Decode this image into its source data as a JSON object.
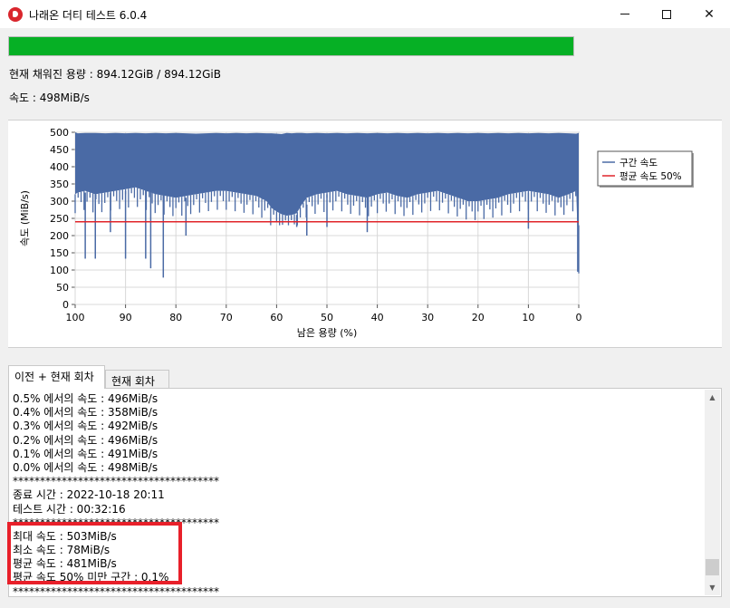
{
  "window": {
    "title": "나래온 더티 테스트 6.0.4"
  },
  "progress": {
    "fraction": 1.0,
    "color": "#06b025"
  },
  "status": {
    "capacity": "현재 채워진 용량 : 894.12GiB / 894.12GiB",
    "speed": "속도 : 498MiB/s"
  },
  "chart_data": {
    "type": "area",
    "xlabel": "남은 용량 (%)",
    "ylabel": "속도 (MiB/s)",
    "xlim": [
      100,
      0
    ],
    "ylim": [
      0,
      500
    ],
    "x_ticks": [
      "100",
      "90",
      "80",
      "70",
      "60",
      "50",
      "40",
      "30",
      "20",
      "10",
      "0"
    ],
    "y_ticks": [
      "0",
      "50",
      "100",
      "150",
      "200",
      "250",
      "300",
      "350",
      "400",
      "450",
      "500"
    ],
    "grid": true,
    "legend_position": "right",
    "series": [
      {
        "name": "구간 속도",
        "color": "#4a6aa5",
        "x": [
          100,
          99.5,
          98,
          96,
          94,
          92,
          90,
          88,
          86,
          84,
          82,
          80,
          78,
          76,
          74,
          72,
          70,
          68,
          66,
          64,
          62,
          61,
          60,
          59,
          58,
          57,
          56,
          55,
          54,
          52,
          50,
          48,
          46,
          44,
          42,
          40,
          38,
          36,
          34,
          32,
          30,
          28,
          26,
          24,
          22,
          20,
          18,
          16,
          14,
          12,
          10,
          8,
          6,
          4,
          2,
          0.5,
          0
        ],
        "peak": [
          500,
          497,
          498,
          498,
          497,
          498,
          497,
          498,
          497,
          498,
          497,
          498,
          497,
          496,
          497,
          498,
          497,
          498,
          497,
          498,
          497,
          497,
          496,
          495,
          498,
          497,
          498,
          498,
          497,
          498,
          497,
          498,
          497,
          498,
          497,
          498,
          497,
          498,
          497,
          498,
          497,
          498,
          497,
          498,
          497,
          498,
          497,
          498,
          497,
          498,
          497,
          498,
          497,
          498,
          497,
          496,
          498
        ],
        "floor": [
          320,
          325,
          330,
          320,
          325,
          330,
          335,
          340,
          330,
          320,
          315,
          310,
          315,
          320,
          325,
          330,
          330,
          325,
          320,
          315,
          300,
          280,
          270,
          262,
          258,
          260,
          265,
          290,
          310,
          320,
          325,
          330,
          320,
          315,
          310,
          320,
          325,
          315,
          310,
          320,
          325,
          330,
          320,
          310,
          300,
          300,
          305,
          310,
          320,
          325,
          330,
          325,
          320,
          310,
          320,
          330,
          90
        ],
        "dips": [
          {
            "x": 98,
            "y": 133
          },
          {
            "x": 96,
            "y": 133
          },
          {
            "x": 93,
            "y": 210
          },
          {
            "x": 90,
            "y": 133
          },
          {
            "x": 86,
            "y": 133
          },
          {
            "x": 85,
            "y": 105
          },
          {
            "x": 82.5,
            "y": 78
          },
          {
            "x": 78,
            "y": 200
          },
          {
            "x": 56,
            "y": 225
          },
          {
            "x": 54,
            "y": 200
          },
          {
            "x": 50,
            "y": 225
          },
          {
            "x": 42,
            "y": 210
          },
          {
            "x": 10,
            "y": 220
          },
          {
            "x": 0.2,
            "y": 95
          }
        ]
      },
      {
        "name": "평균 속도 50%",
        "color": "#e0242a",
        "value": 240
      }
    ]
  },
  "tabs": [
    {
      "label": "이전 + 현재 회차",
      "active": true
    },
    {
      "label": "현재 회차",
      "active": false
    }
  ],
  "log": {
    "lines": [
      "0.5% 에서의 속도 : 496MiB/s",
      "0.4% 에서의 속도 : 358MiB/s",
      "0.3% 에서의 속도 : 492MiB/s",
      "0.2% 에서의 속도 : 496MiB/s",
      "0.1% 에서의 속도 : 491MiB/s",
      "0.0% 에서의 속도 : 498MiB/s",
      "**************************************",
      "종료 시간 : 2022-10-18 20:11",
      "테스트 시간 : 00:32:16",
      "**************************************",
      "최대 속도 : 503MiB/s",
      "최소 속도 : 78MiB/s",
      "평균 속도 : 481MiB/s",
      "평균 속도 50% 미만 구간 : 0.1%",
      "**************************************"
    ],
    "scroll_position": 0.97
  },
  "icons": {
    "app": "naraeon-app-icon",
    "scroll_up": "scroll-up-arrow-icon",
    "scroll_down": "scroll-down-arrow-icon"
  },
  "highlight_color": "#e8202a"
}
